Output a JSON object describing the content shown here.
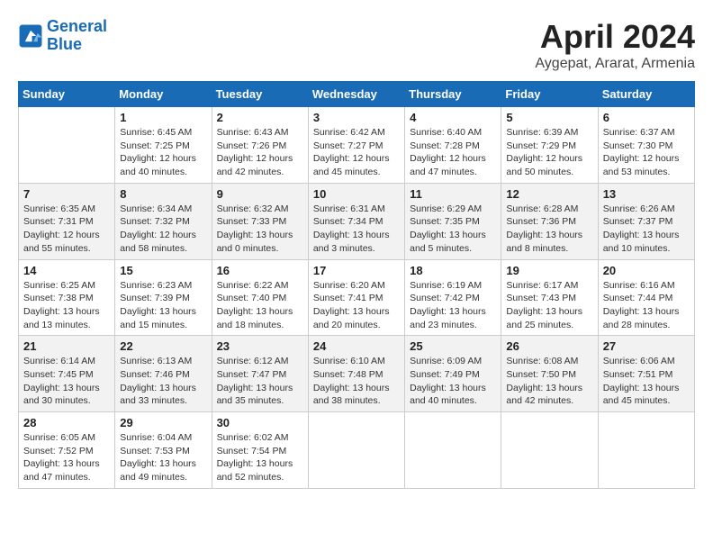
{
  "header": {
    "logo_line1": "General",
    "logo_line2": "Blue",
    "title": "April 2024",
    "subtitle": "Aygepat, Ararat, Armenia"
  },
  "days_of_week": [
    "Sunday",
    "Monday",
    "Tuesday",
    "Wednesday",
    "Thursday",
    "Friday",
    "Saturday"
  ],
  "weeks": [
    [
      {
        "day": "",
        "info": ""
      },
      {
        "day": "1",
        "info": "Sunrise: 6:45 AM\nSunset: 7:25 PM\nDaylight: 12 hours\nand 40 minutes."
      },
      {
        "day": "2",
        "info": "Sunrise: 6:43 AM\nSunset: 7:26 PM\nDaylight: 12 hours\nand 42 minutes."
      },
      {
        "day": "3",
        "info": "Sunrise: 6:42 AM\nSunset: 7:27 PM\nDaylight: 12 hours\nand 45 minutes."
      },
      {
        "day": "4",
        "info": "Sunrise: 6:40 AM\nSunset: 7:28 PM\nDaylight: 12 hours\nand 47 minutes."
      },
      {
        "day": "5",
        "info": "Sunrise: 6:39 AM\nSunset: 7:29 PM\nDaylight: 12 hours\nand 50 minutes."
      },
      {
        "day": "6",
        "info": "Sunrise: 6:37 AM\nSunset: 7:30 PM\nDaylight: 12 hours\nand 53 minutes."
      }
    ],
    [
      {
        "day": "7",
        "info": "Sunrise: 6:35 AM\nSunset: 7:31 PM\nDaylight: 12 hours\nand 55 minutes."
      },
      {
        "day": "8",
        "info": "Sunrise: 6:34 AM\nSunset: 7:32 PM\nDaylight: 12 hours\nand 58 minutes."
      },
      {
        "day": "9",
        "info": "Sunrise: 6:32 AM\nSunset: 7:33 PM\nDaylight: 13 hours\nand 0 minutes."
      },
      {
        "day": "10",
        "info": "Sunrise: 6:31 AM\nSunset: 7:34 PM\nDaylight: 13 hours\nand 3 minutes."
      },
      {
        "day": "11",
        "info": "Sunrise: 6:29 AM\nSunset: 7:35 PM\nDaylight: 13 hours\nand 5 minutes."
      },
      {
        "day": "12",
        "info": "Sunrise: 6:28 AM\nSunset: 7:36 PM\nDaylight: 13 hours\nand 8 minutes."
      },
      {
        "day": "13",
        "info": "Sunrise: 6:26 AM\nSunset: 7:37 PM\nDaylight: 13 hours\nand 10 minutes."
      }
    ],
    [
      {
        "day": "14",
        "info": "Sunrise: 6:25 AM\nSunset: 7:38 PM\nDaylight: 13 hours\nand 13 minutes."
      },
      {
        "day": "15",
        "info": "Sunrise: 6:23 AM\nSunset: 7:39 PM\nDaylight: 13 hours\nand 15 minutes."
      },
      {
        "day": "16",
        "info": "Sunrise: 6:22 AM\nSunset: 7:40 PM\nDaylight: 13 hours\nand 18 minutes."
      },
      {
        "day": "17",
        "info": "Sunrise: 6:20 AM\nSunset: 7:41 PM\nDaylight: 13 hours\nand 20 minutes."
      },
      {
        "day": "18",
        "info": "Sunrise: 6:19 AM\nSunset: 7:42 PM\nDaylight: 13 hours\nand 23 minutes."
      },
      {
        "day": "19",
        "info": "Sunrise: 6:17 AM\nSunset: 7:43 PM\nDaylight: 13 hours\nand 25 minutes."
      },
      {
        "day": "20",
        "info": "Sunrise: 6:16 AM\nSunset: 7:44 PM\nDaylight: 13 hours\nand 28 minutes."
      }
    ],
    [
      {
        "day": "21",
        "info": "Sunrise: 6:14 AM\nSunset: 7:45 PM\nDaylight: 13 hours\nand 30 minutes."
      },
      {
        "day": "22",
        "info": "Sunrise: 6:13 AM\nSunset: 7:46 PM\nDaylight: 13 hours\nand 33 minutes."
      },
      {
        "day": "23",
        "info": "Sunrise: 6:12 AM\nSunset: 7:47 PM\nDaylight: 13 hours\nand 35 minutes."
      },
      {
        "day": "24",
        "info": "Sunrise: 6:10 AM\nSunset: 7:48 PM\nDaylight: 13 hours\nand 38 minutes."
      },
      {
        "day": "25",
        "info": "Sunrise: 6:09 AM\nSunset: 7:49 PM\nDaylight: 13 hours\nand 40 minutes."
      },
      {
        "day": "26",
        "info": "Sunrise: 6:08 AM\nSunset: 7:50 PM\nDaylight: 13 hours\nand 42 minutes."
      },
      {
        "day": "27",
        "info": "Sunrise: 6:06 AM\nSunset: 7:51 PM\nDaylight: 13 hours\nand 45 minutes."
      }
    ],
    [
      {
        "day": "28",
        "info": "Sunrise: 6:05 AM\nSunset: 7:52 PM\nDaylight: 13 hours\nand 47 minutes."
      },
      {
        "day": "29",
        "info": "Sunrise: 6:04 AM\nSunset: 7:53 PM\nDaylight: 13 hours\nand 49 minutes."
      },
      {
        "day": "30",
        "info": "Sunrise: 6:02 AM\nSunset: 7:54 PM\nDaylight: 13 hours\nand 52 minutes."
      },
      {
        "day": "",
        "info": ""
      },
      {
        "day": "",
        "info": ""
      },
      {
        "day": "",
        "info": ""
      },
      {
        "day": "",
        "info": ""
      }
    ]
  ]
}
